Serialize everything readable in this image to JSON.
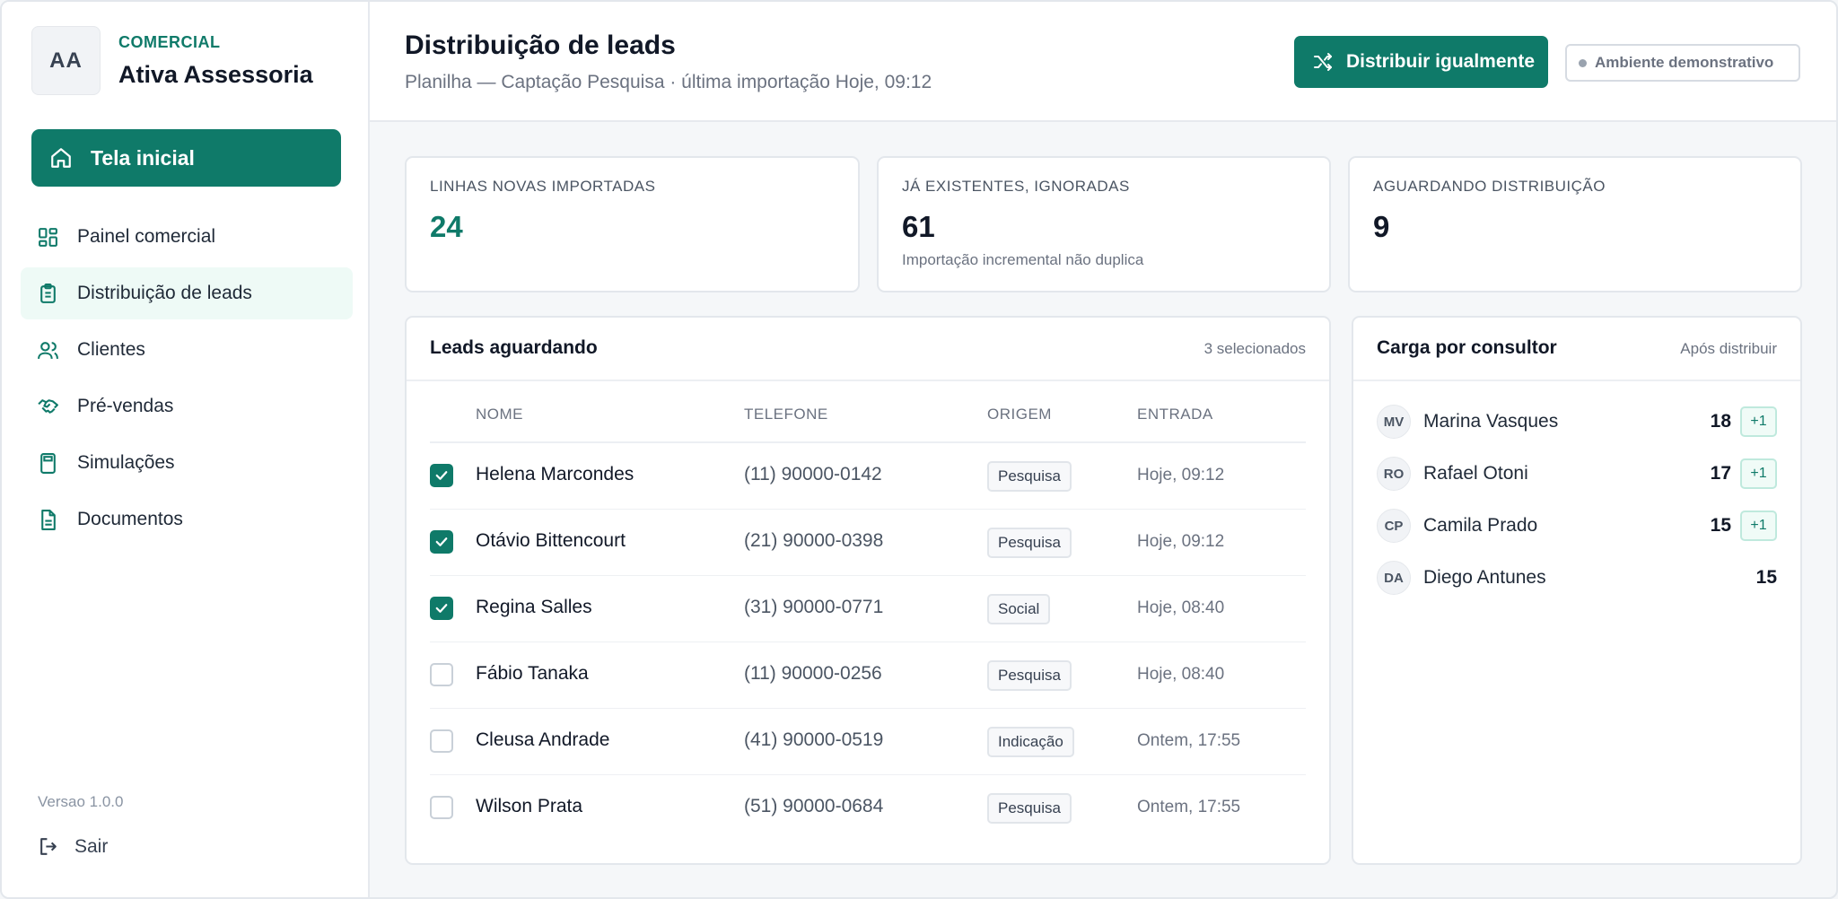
{
  "brand": {
    "initials": "AA",
    "eyebrow": "COMERCIAL",
    "name": "Ativa Assessoria"
  },
  "sidebar": {
    "home_label": "Tela inicial",
    "items": [
      {
        "label": "Painel comercial",
        "icon": "dashboard-icon"
      },
      {
        "label": "Distribuição de leads",
        "icon": "clipboard-icon",
        "active": true
      },
      {
        "label": "Clientes",
        "icon": "users-icon"
      },
      {
        "label": "Pré-vendas",
        "icon": "handshake-icon"
      },
      {
        "label": "Simulações",
        "icon": "calculator-icon"
      },
      {
        "label": "Documentos",
        "icon": "document-icon"
      }
    ],
    "version": "Versao 1.0.0",
    "logout_label": "Sair"
  },
  "header": {
    "title": "Distribuição de leads",
    "subtitle": "Planilha — Captação Pesquisa · última importação Hoje, 09:12",
    "distribute_label": "Distribuir igualmente",
    "demo_label": "Ambiente demonstrativo"
  },
  "stats": [
    {
      "label": "LINHAS NOVAS IMPORTADAS",
      "value": "24",
      "note": ""
    },
    {
      "label": "JÁ EXISTENTES, IGNORADAS",
      "value": "61",
      "note": "Importação incremental não duplica"
    },
    {
      "label": "AGUARDANDO DISTRIBUIÇÃO",
      "value": "9",
      "note": ""
    }
  ],
  "leads": {
    "title": "Leads aguardando",
    "selected_label": "3 selecionados",
    "columns": [
      "NOME",
      "TELEFONE",
      "ORIGEM",
      "ENTRADA"
    ],
    "rows": [
      {
        "checked": true,
        "name": "Helena Marcondes",
        "phone": "(11) 90000-0142",
        "origin": "Pesquisa",
        "date": "Hoje, 09:12"
      },
      {
        "checked": true,
        "name": "Otávio Bittencourt",
        "phone": "(21) 90000-0398",
        "origin": "Pesquisa",
        "date": "Hoje, 09:12"
      },
      {
        "checked": true,
        "name": "Regina Salles",
        "phone": "(31) 90000-0771",
        "origin": "Social",
        "date": "Hoje, 08:40"
      },
      {
        "checked": false,
        "name": "Fábio Tanaka",
        "phone": "(11) 90000-0256",
        "origin": "Pesquisa",
        "date": "Hoje, 08:40"
      },
      {
        "checked": false,
        "name": "Cleusa Andrade",
        "phone": "(41) 90000-0519",
        "origin": "Indicação",
        "date": "Ontem, 17:55"
      },
      {
        "checked": false,
        "name": "Wilson Prata",
        "phone": "(51) 90000-0684",
        "origin": "Pesquisa",
        "date": "Ontem, 17:55"
      }
    ]
  },
  "load": {
    "title": "Carga por consultor",
    "meta": "Após distribuir",
    "consultants": [
      {
        "initials": "MV",
        "name": "Marina Vasques",
        "count": "18",
        "delta": "+1"
      },
      {
        "initials": "RO",
        "name": "Rafael Otoni",
        "count": "17",
        "delta": "+1"
      },
      {
        "initials": "CP",
        "name": "Camila Prado",
        "count": "15",
        "delta": "+1"
      },
      {
        "initials": "DA",
        "name": "Diego Antunes",
        "count": "15",
        "delta": ""
      }
    ]
  },
  "colors": {
    "accent": "#0f7a69",
    "accent_soft": "#eefaf6"
  }
}
